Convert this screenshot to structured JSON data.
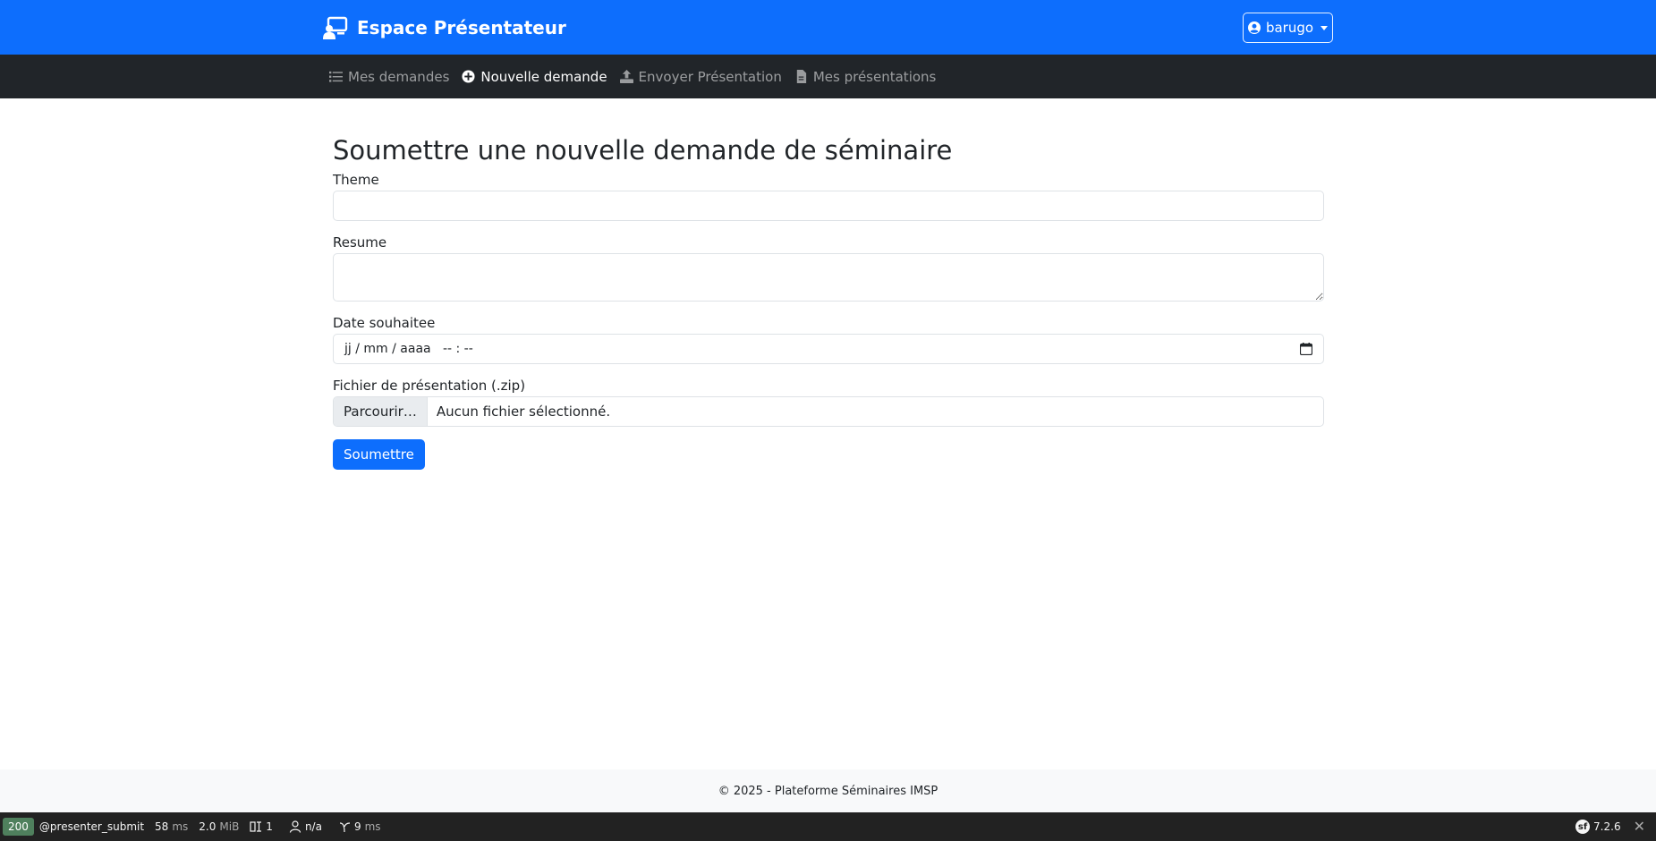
{
  "header": {
    "brand_title": "Espace Présentateur",
    "brand_icon": "presenter-icon",
    "user_name": "barugo",
    "colors": {
      "primary": "#0d6efd",
      "dark": "#212529"
    }
  },
  "nav": {
    "items": [
      {
        "label": "Mes demandes",
        "icon": "list-icon",
        "active": false
      },
      {
        "label": "Nouvelle demande",
        "icon": "plus-circle-icon",
        "active": true
      },
      {
        "label": "Envoyer Présentation",
        "icon": "upload-icon",
        "active": false
      },
      {
        "label": "Mes présentations",
        "icon": "file-icon",
        "active": false
      }
    ]
  },
  "form": {
    "title": "Soumettre une nouvelle demande de séminaire",
    "theme_label": "Theme",
    "theme_value": "",
    "resume_label": "Resume",
    "resume_value": "",
    "date_label": "Date souhaitee",
    "date_placeholder": "jj / mm / aaaa   -- : --",
    "file_label": "Fichier de présentation (.zip)",
    "file_button": "Parcourir…",
    "file_none": "Aucun fichier sélectionné.",
    "submit_label": "Soumettre"
  },
  "footer": {
    "text": "© 2025 - Plateforme Séminaires IMSP"
  },
  "debug_toolbar": {
    "status_code": "200",
    "route": "@presenter_submit",
    "time_value": "58",
    "time_unit": "ms",
    "memory_value": "2.0",
    "memory_unit": "MiB",
    "forms_count": "1",
    "user": "n/a",
    "db_value": "9",
    "db_unit": "ms",
    "version": "7.2.6"
  }
}
